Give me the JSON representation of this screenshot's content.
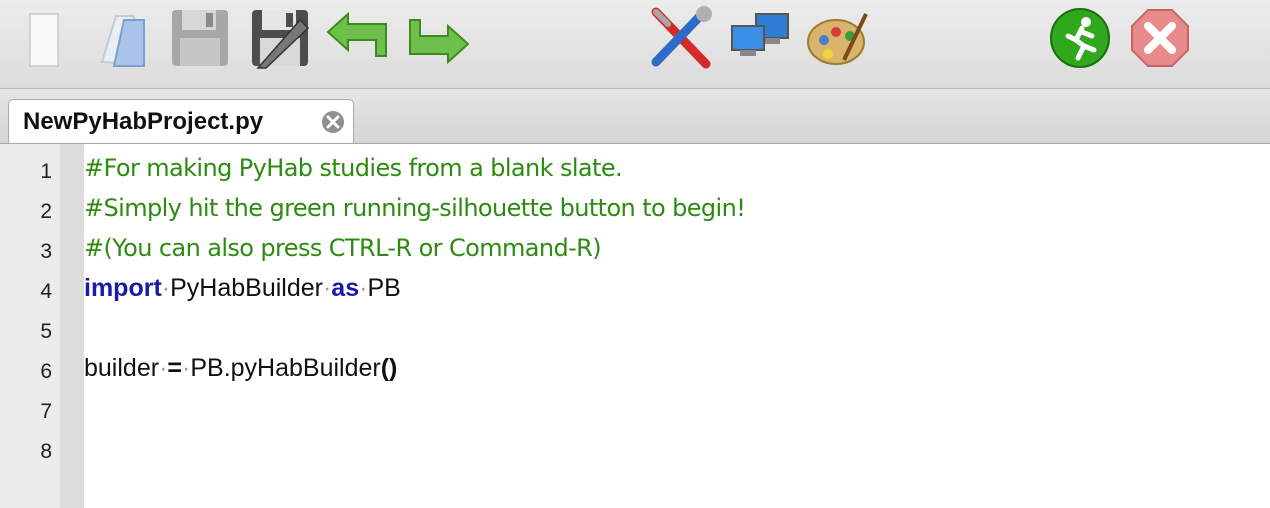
{
  "toolbar": {
    "buttons": [
      {
        "name": "new-file",
        "icon": "new-file-icon"
      },
      {
        "name": "open-folder",
        "icon": "folder-icon"
      },
      {
        "name": "save",
        "icon": "floppy-disk-icon"
      },
      {
        "name": "save-as",
        "icon": "floppy-pencil-icon"
      },
      {
        "name": "undo",
        "icon": "undo-arrow-icon"
      },
      {
        "name": "redo",
        "icon": "redo-arrow-icon"
      },
      {
        "name": "tools",
        "icon": "wrench-screwdriver-icon"
      },
      {
        "name": "monitors",
        "icon": "monitors-icon"
      },
      {
        "name": "palette",
        "icon": "palette-icon"
      },
      {
        "name": "run",
        "icon": "running-man-icon"
      },
      {
        "name": "stop",
        "icon": "stop-x-icon"
      }
    ]
  },
  "tab": {
    "title": "NewPyHabProject.py"
  },
  "editor": {
    "line_numbers": [
      "1",
      "2",
      "3",
      "4",
      "5",
      "6",
      "7",
      "8"
    ],
    "lines": {
      "l1": "#For making PyHab studies from a blank slate.",
      "l2": "#Simply hit the green running-silhouette button to begin!",
      "l3": "#(You can also press CTRL-R or Command-R)",
      "l4": {
        "kw1": "import",
        "name": "PyHabBuilder",
        "kw2": "as",
        "alias": "PB"
      },
      "l6": {
        "var": "builder",
        "op": "=",
        "call1": "PB",
        "call2": ".pyHabBuilder",
        "paren": "()"
      }
    }
  },
  "colors": {
    "comment": "#2e8b12",
    "keyword": "#1a1aa6",
    "run": "#2fa81c",
    "stop": "#e98b8b"
  }
}
